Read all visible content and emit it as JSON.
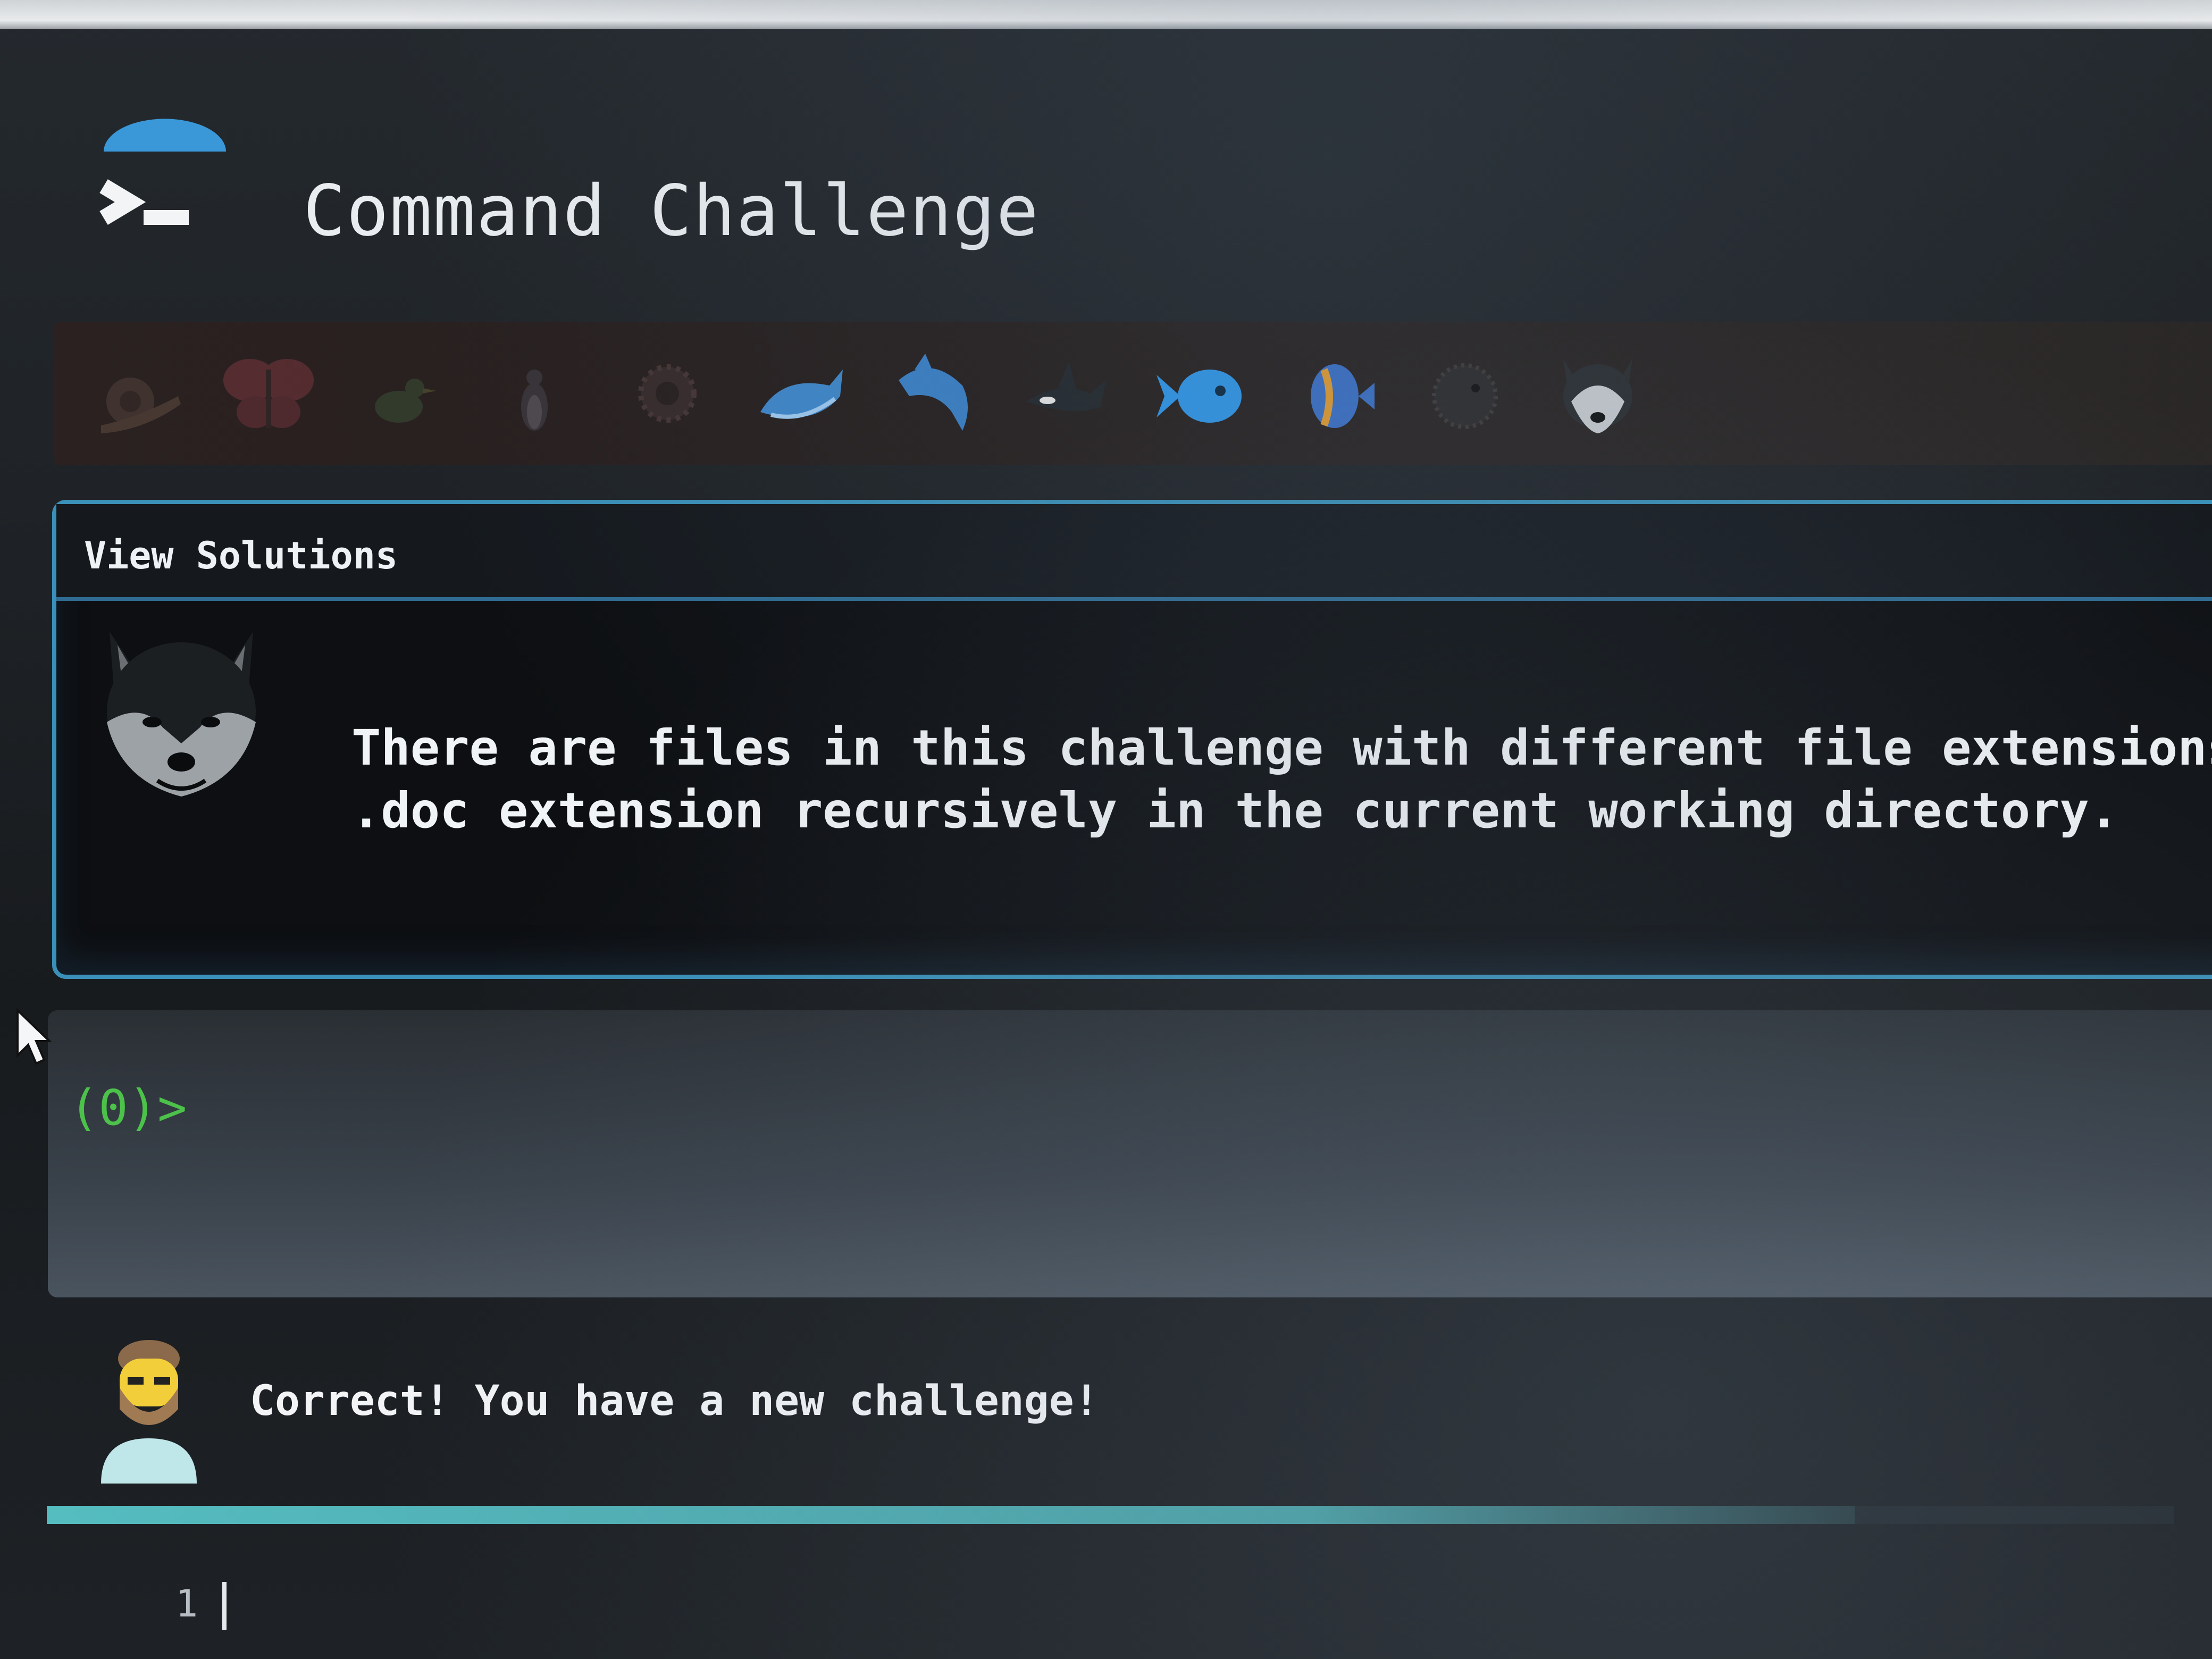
{
  "header": {
    "title": "Command Challenge",
    "logo_icon": "terminal-prompt-icon"
  },
  "levels": [
    {
      "icon": "snail-icon",
      "state": "locked"
    },
    {
      "icon": "butterfly-icon",
      "state": "locked"
    },
    {
      "icon": "bird-icon",
      "state": "locked"
    },
    {
      "icon": "penguin-icon",
      "state": "locked"
    },
    {
      "icon": "spiky-creature-icon",
      "state": "locked"
    },
    {
      "icon": "whale-icon",
      "state": "unlocked"
    },
    {
      "icon": "dolphin-icon",
      "state": "unlocked"
    },
    {
      "icon": "orca-icon",
      "state": "unlocked"
    },
    {
      "icon": "fish-icon",
      "state": "current"
    },
    {
      "icon": "tropical-fish-icon",
      "state": "unlocked"
    },
    {
      "icon": "pufferfish-icon",
      "state": "unlocked"
    },
    {
      "icon": "husky-icon",
      "state": "unlocked"
    }
  ],
  "challenge": {
    "view_solutions": "View Solutions",
    "avatar_icon": "husky-icon",
    "text_line1": "There are files in this challenge with different file extensions",
    "text_line2": ".doc extension recursively in the current working directory."
  },
  "terminal": {
    "prompt": "(0)>"
  },
  "feedback": {
    "avatar_icon": "man-bearded-icon",
    "message": "Correct! You have a new challenge!",
    "progress_fraction": 0.85
  },
  "editor": {
    "line_number": "1"
  },
  "colors": {
    "accent": "#3a90b8",
    "prompt": "#4cc24a",
    "progress": "#55bcc0",
    "background": "#1b1e22"
  }
}
